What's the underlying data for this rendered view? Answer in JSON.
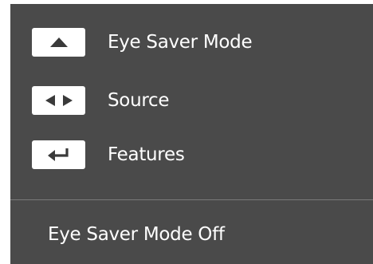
{
  "menu": {
    "items": [
      {
        "key_icon": "up-arrow-icon",
        "label": "Eye Saver Mode"
      },
      {
        "key_icon": "left-right-arrows-icon",
        "label": "Source"
      },
      {
        "key_icon": "enter-return-icon",
        "label": "Features"
      }
    ]
  },
  "status": {
    "text": "Eye Saver Mode Off"
  },
  "colors": {
    "background": "#4a4a4a",
    "text": "#ffffff",
    "key_face": "#ffffff",
    "key_glyph": "#3a3a3a",
    "divider": "#7a7a7a"
  }
}
